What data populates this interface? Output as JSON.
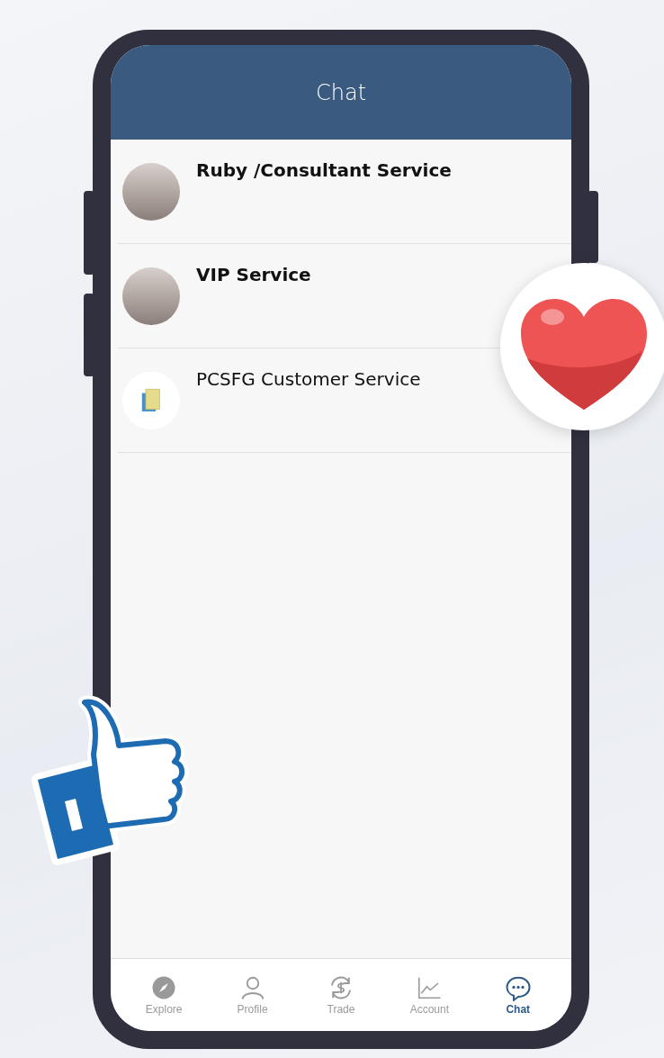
{
  "header": {
    "title": "Chat"
  },
  "chats": [
    {
      "name": "Ruby /Consultant Service",
      "kind": "photo"
    },
    {
      "name": "VIP Service",
      "kind": "photo"
    },
    {
      "name": "PCSFG Customer Service",
      "kind": "document"
    }
  ],
  "tab_bar": [
    {
      "label": "Explore",
      "selected": false
    },
    {
      "label": "Profile",
      "selected": false
    },
    {
      "label": "Trade",
      "selected": false
    },
    {
      "label": "Account",
      "selected": false
    },
    {
      "label": "Chat",
      "selected": true
    }
  ]
}
